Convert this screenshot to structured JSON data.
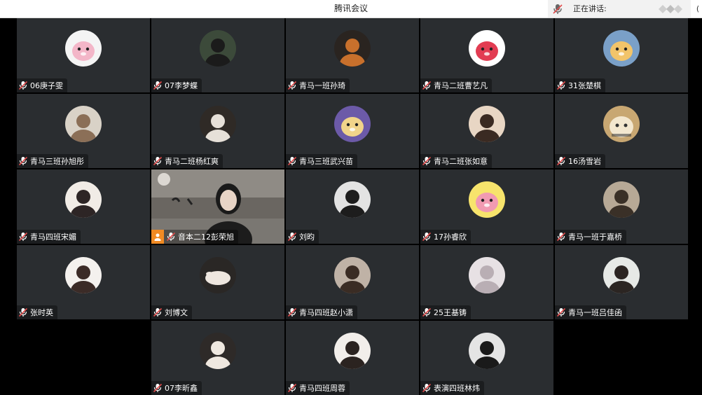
{
  "window": {
    "title": "腾讯会议",
    "speaking_label": "正在讲话:",
    "corner_text": "("
  },
  "participants": [
    {
      "name": "06庚子雯",
      "avatar": "cartoon-pig",
      "bg": "#f4f4f4",
      "fg": "#f3b6c8"
    },
    {
      "name": "07李梦蝶",
      "avatar": "photo-dark",
      "bg": "#3c4a3a",
      "fg": "#1b1b1b"
    },
    {
      "name": "青马一班孙琦",
      "avatar": "photo-orange",
      "bg": "#2a2420",
      "fg": "#c8702c"
    },
    {
      "name": "青马二班曹艺凡",
      "avatar": "cartoon-dog",
      "bg": "#ffffff",
      "fg": "#e23c52"
    },
    {
      "name": "31张楚棋",
      "avatar": "cartoon-princess",
      "bg": "#7aa0c8",
      "fg": "#f2c46a"
    },
    {
      "name": "青马三班孙旭彤",
      "avatar": "photo-light",
      "bg": "#d9d2c7",
      "fg": "#8b6f57"
    },
    {
      "name": "青马二班杨红爽",
      "avatar": "photo-dark",
      "bg": "#2f2a26",
      "fg": "#e6e0d8"
    },
    {
      "name": "青马三班武兴苗",
      "avatar": "cartoon-rapunzel",
      "bg": "#6c5aa8",
      "fg": "#f1d48a"
    },
    {
      "name": "青马二班张如意",
      "avatar": "photo-portrait",
      "bg": "#e8d6c4",
      "fg": "#3a2a22"
    },
    {
      "name": "16汤雪岩",
      "avatar": "photo-cat",
      "bg": "#c8a772",
      "fg": "#f3e7cf"
    },
    {
      "name": "青马四班宋媚",
      "avatar": "photo-portrait",
      "bg": "#f1ece6",
      "fg": "#2d2525"
    },
    {
      "name": "音本二12彭荣旭",
      "avatar": "video",
      "bg": "#6e6c68",
      "fg": "#1a1a1a"
    },
    {
      "name": "刘昀",
      "avatar": "photo-dark",
      "bg": "#e3e3e3",
      "fg": "#1d1d1d"
    },
    {
      "name": "17孙睿欣",
      "avatar": "cartoon-pig",
      "bg": "#f7e46c",
      "fg": "#f19ab2"
    },
    {
      "name": "青马一班于嘉桥",
      "avatar": "photo-light",
      "bg": "#b7a996",
      "fg": "#3a3027"
    },
    {
      "name": "张时英",
      "avatar": "photo-portrait",
      "bg": "#f4f1ee",
      "fg": "#3b2b27"
    },
    {
      "name": "刘博文",
      "avatar": "photo-rabbit",
      "bg": "#2a2725",
      "fg": "#efe7df"
    },
    {
      "name": "青马四班赵小潇",
      "avatar": "photo-light",
      "bg": "#bfb2a6",
      "fg": "#3a2c24"
    },
    {
      "name": "25王基铸",
      "avatar": "photo-light",
      "bg": "#e7e1e4",
      "fg": "#b9aeb4"
    },
    {
      "name": "青马一班吕佳函",
      "avatar": "photo-portrait",
      "bg": "#e6e9e6",
      "fg": "#2b2522"
    },
    {
      "name": "07李昕鑫",
      "avatar": "photo-portrait",
      "bg": "#2e2a28",
      "fg": "#efe8e0"
    },
    {
      "name": "青马四班周蓉",
      "avatar": "photo-portrait",
      "bg": "#f2eeea",
      "fg": "#2b2320"
    },
    {
      "name": "表演四班林炜",
      "avatar": "photo-dark",
      "bg": "#e4e4e4",
      "fg": "#1a1a1a"
    }
  ],
  "colors": {
    "tile_bg": "#2a2d30",
    "grid_bg": "#000000",
    "host_badge": "#f08a24",
    "mic_red": "#e04b4b"
  }
}
